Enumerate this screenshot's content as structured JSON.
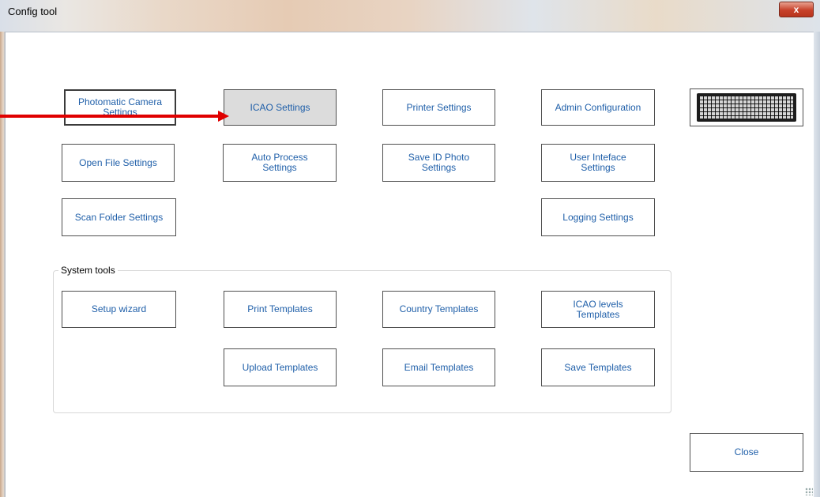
{
  "window": {
    "title": "Config tool",
    "close_glyph": "x"
  },
  "settings": {
    "photomatic_camera": "Photomatic Camera\nSettings",
    "icao": "ICAO Settings",
    "printer": "Printer Settings",
    "admin": "Admin Configuration",
    "open_file": "Open File Settings",
    "auto_process": "Auto Process\nSettings",
    "save_id_photo": "Save ID Photo\nSettings",
    "user_interface": "User Inteface\nSettings",
    "scan_folder": "Scan Folder Settings",
    "logging": "Logging Settings",
    "keyboard_icon": "keyboard-icon"
  },
  "system_tools": {
    "label": "System tools",
    "setup_wizard": "Setup wizard",
    "print_templates": "Print Templates",
    "country_templates": "Country Templates",
    "icao_levels_templates": "ICAO levels\nTemplates",
    "upload_templates": "Upload Templates",
    "email_templates": "Email Templates",
    "save_templates": "Save Templates"
  },
  "footer": {
    "close": "Close"
  },
  "annotation": {
    "arrow_color": "#e00000"
  },
  "colors": {
    "button_text": "#1f5fa9",
    "pressed_button_bg": "#dcdcdc"
  }
}
